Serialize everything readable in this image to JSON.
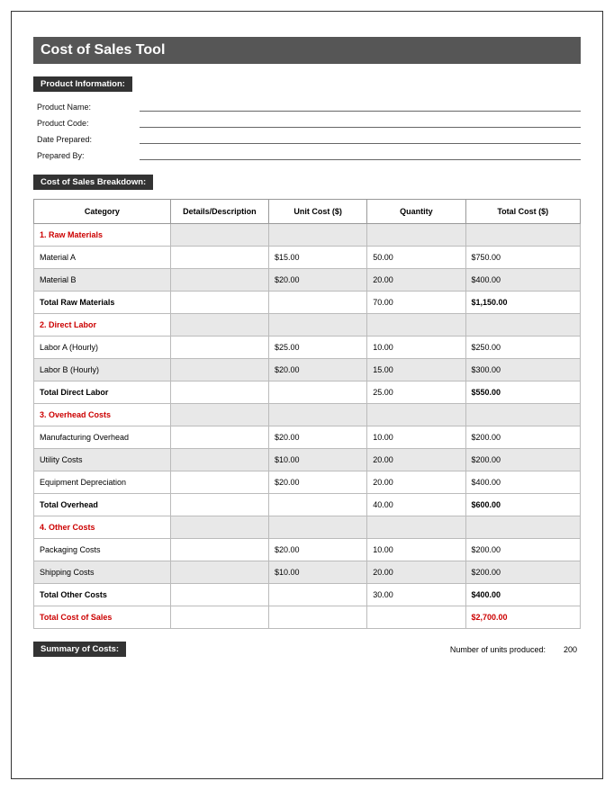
{
  "title": "Cost of Sales Tool",
  "sections": {
    "product_info_header": "Product Information:",
    "breakdown_header": "Cost of Sales Breakdown:",
    "summary_header": "Summary of Costs:"
  },
  "product_info": {
    "labels": {
      "name": "Product Name:",
      "code": "Product Code:",
      "date": "Date Prepared:",
      "prepared_by": "Prepared By:"
    },
    "values": {
      "name": "",
      "code": "",
      "date": "",
      "prepared_by": ""
    }
  },
  "columns": {
    "category": "Category",
    "details": "Details/Description",
    "unit_cost": "Unit Cost ($)",
    "quantity": "Quantity",
    "total_cost": "Total Cost ($)"
  },
  "rows": [
    {
      "type": "cat",
      "category": "1. Raw Materials"
    },
    {
      "type": "data",
      "category": "Material A",
      "unit_cost": "$15.00",
      "quantity": "50.00",
      "total_cost": "$750.00"
    },
    {
      "type": "data-alt",
      "category": "Material B",
      "unit_cost": "$20.00",
      "quantity": "20.00",
      "total_cost": "$400.00"
    },
    {
      "type": "subtotal",
      "category": "Total Raw Materials",
      "quantity": "70.00",
      "total_cost": "$1,150.00"
    },
    {
      "type": "cat",
      "category": "2. Direct Labor"
    },
    {
      "type": "data",
      "category": "Labor A (Hourly)",
      "unit_cost": "$25.00",
      "quantity": "10.00",
      "total_cost": "$250.00"
    },
    {
      "type": "data-alt",
      "category": "Labor B (Hourly)",
      "unit_cost": "$20.00",
      "quantity": "15.00",
      "total_cost": "$300.00"
    },
    {
      "type": "subtotal",
      "category": "Total Direct Labor",
      "quantity": "25.00",
      "total_cost": "$550.00"
    },
    {
      "type": "cat",
      "category": "3. Overhead Costs"
    },
    {
      "type": "data",
      "category": "Manufacturing Overhead",
      "unit_cost": "$20.00",
      "quantity": "10.00",
      "total_cost": "$200.00"
    },
    {
      "type": "data-alt",
      "category": "Utility Costs",
      "unit_cost": "$10.00",
      "quantity": "20.00",
      "total_cost": "$200.00"
    },
    {
      "type": "data",
      "category": "Equipment Depreciation",
      "unit_cost": "$20.00",
      "quantity": "20.00",
      "total_cost": "$400.00"
    },
    {
      "type": "subtotal",
      "category": "Total Overhead",
      "quantity": "40.00",
      "total_cost": "$600.00"
    },
    {
      "type": "cat",
      "category": "4. Other Costs"
    },
    {
      "type": "data",
      "category": "Packaging Costs",
      "unit_cost": "$20.00",
      "quantity": "10.00",
      "total_cost": "$200.00"
    },
    {
      "type": "data-alt",
      "category": "Shipping Costs",
      "unit_cost": "$10.00",
      "quantity": "20.00",
      "total_cost": "$200.00"
    },
    {
      "type": "subtotal",
      "category": "Total Other Costs",
      "quantity": "30.00",
      "total_cost": "$400.00"
    },
    {
      "type": "grand",
      "category": "Total Cost of Sales",
      "total_cost": "$2,700.00"
    }
  ],
  "summary": {
    "units_label": "Number of units produced:",
    "units_value": "200"
  }
}
